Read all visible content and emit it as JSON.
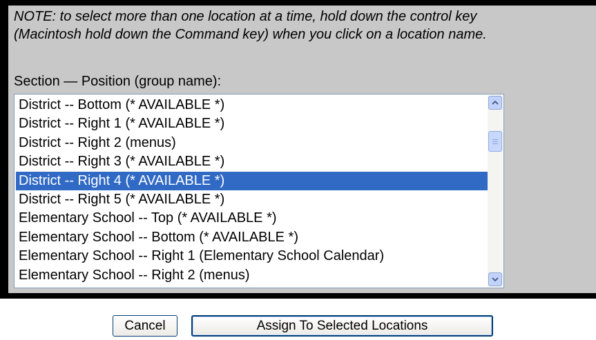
{
  "note": {
    "line1": "NOTE: to select more than one location at a time, hold down the control key",
    "line2": "(Macintosh hold down the Command key) when you click on a location name."
  },
  "section_label": "Section — Position (group name):",
  "locations": {
    "items": [
      "District -- Bottom (* AVAILABLE *)",
      "District -- Right 1 (* AVAILABLE *)",
      "District -- Right 2 (menus)",
      "District -- Right 3 (* AVAILABLE *)",
      "District -- Right 4 (* AVAILABLE *)",
      "District -- Right 5 (* AVAILABLE *)",
      "Elementary School -- Top (* AVAILABLE *)",
      "Elementary School -- Bottom (* AVAILABLE *)",
      "Elementary School -- Right 1 (Elementary School Calendar)",
      "Elementary School -- Right 2 (menus)"
    ],
    "selected": "District -- Right 4 (* AVAILABLE *)",
    "scroll_up_icon": "chevron-up-icon",
    "scroll_down_icon": "chevron-down-icon"
  },
  "buttons": {
    "cancel": "Cancel",
    "assign": "Assign To Selected Locations"
  },
  "colors": {
    "selection": "#316ac5",
    "panel_bg": "#c8c8c8"
  }
}
